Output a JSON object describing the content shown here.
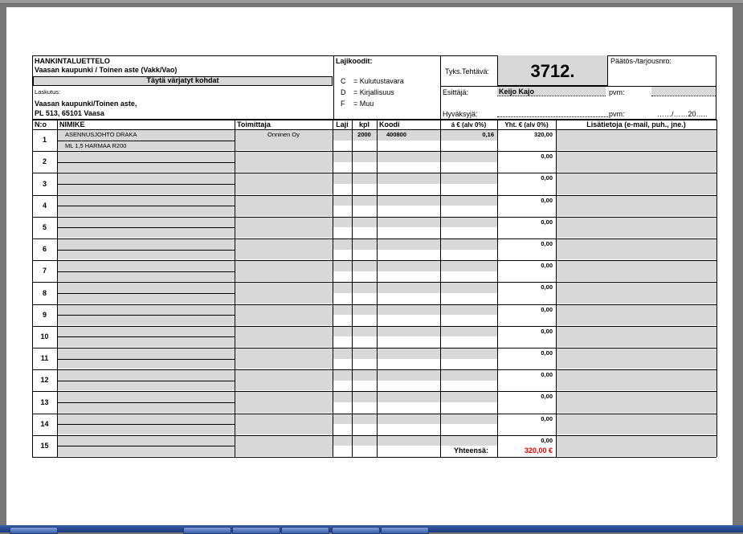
{
  "header": {
    "title": "HANKINTALUETTELO",
    "subtitle": "Vaasan kaupunki / Toinen aste (Vakk/Vao)",
    "fill_note": "Täytä värjatyt kohdat",
    "billing_label": "Laskutus:",
    "billing_line1": "Vaasan kaupunki/Toinen aste,",
    "billing_line2": "PL 513, 65101 Vaasa",
    "codes_label": "Lajikoodit:",
    "codes": [
      {
        "code": "C",
        "text": "= Kulutustavara"
      },
      {
        "code": "D",
        "text": "= Kirjallisuus"
      },
      {
        "code": "F",
        "text": "= Muu"
      }
    ],
    "task_label": "Tyks.Tehtävä:",
    "task_number": "3712.",
    "decision_label": "Päätös-/tarjousnro:",
    "presenter_label": "Esittäjä:",
    "presenter_value": "Keijo Kajo",
    "approver_label": "Hyväksyjä:",
    "pvm_label1": "pvm:",
    "pvm_label2": "pvm:",
    "pvm_value2": "……/……20…..",
    "pvm_value1": ""
  },
  "columns": {
    "no": "N:o",
    "item": "NIMIKE",
    "supplier": "Toimittaja",
    "type": "Laji",
    "qty": "kpl",
    "code": "Koodi",
    "unit_price": "á € (alv 0%)",
    "total": "Yht. € (alv 0%)",
    "info": "Lisätietoja (e-mail, puh., jne.)"
  },
  "rows": [
    {
      "no": "1",
      "line1": "ASENNUSJOHTO DRAKA",
      "line2": "ML 1,5 HARMAA R200",
      "supplier": "Onninen Oy",
      "qty": "2000",
      "code": "400800",
      "unit": "0,16",
      "total": "320,00"
    },
    {
      "no": "2",
      "line1": "",
      "line2": "",
      "supplier": "",
      "qty": "",
      "code": "",
      "unit": "",
      "total": "0,00"
    },
    {
      "no": "3",
      "line1": "",
      "line2": "",
      "supplier": "",
      "qty": "",
      "code": "",
      "unit": "",
      "total": "0,00"
    },
    {
      "no": "4",
      "line1": "",
      "line2": "",
      "supplier": "",
      "qty": "",
      "code": "",
      "unit": "",
      "total": "0,00"
    },
    {
      "no": "5",
      "line1": "",
      "line2": "",
      "supplier": "",
      "qty": "",
      "code": "",
      "unit": "",
      "total": "0,00"
    },
    {
      "no": "6",
      "line1": "",
      "line2": "",
      "supplier": "",
      "qty": "",
      "code": "",
      "unit": "",
      "total": "0,00"
    },
    {
      "no": "7",
      "line1": "",
      "line2": "",
      "supplier": "",
      "qty": "",
      "code": "",
      "unit": "",
      "total": "0,00"
    },
    {
      "no": "8",
      "line1": "",
      "line2": "",
      "supplier": "",
      "qty": "",
      "code": "",
      "unit": "",
      "total": "0,00"
    },
    {
      "no": "9",
      "line1": "",
      "line2": "",
      "supplier": "",
      "qty": "",
      "code": "",
      "unit": "",
      "total": "0,00"
    },
    {
      "no": "10",
      "line1": "",
      "line2": "",
      "supplier": "",
      "qty": "",
      "code": "",
      "unit": "",
      "total": "0,00"
    },
    {
      "no": "11",
      "line1": "",
      "line2": "",
      "supplier": "",
      "qty": "",
      "code": "",
      "unit": "",
      "total": "0,00"
    },
    {
      "no": "12",
      "line1": "",
      "line2": "",
      "supplier": "",
      "qty": "",
      "code": "",
      "unit": "",
      "total": "0,00"
    },
    {
      "no": "13",
      "line1": "",
      "line2": "",
      "supplier": "",
      "qty": "",
      "code": "",
      "unit": "",
      "total": "0,00"
    },
    {
      "no": "14",
      "line1": "",
      "line2": "",
      "supplier": "",
      "qty": "",
      "code": "",
      "unit": "",
      "total": "0,00"
    },
    {
      "no": "15",
      "line1": "",
      "line2": "",
      "supplier": "",
      "qty": "",
      "code": "",
      "unit": "",
      "total": "0,00"
    }
  ],
  "footer": {
    "sum_label": "Yhteensä:",
    "sum_value": "320,00 €"
  },
  "colors": {
    "shade": "#d8d8d8",
    "sum": "#e00000"
  }
}
